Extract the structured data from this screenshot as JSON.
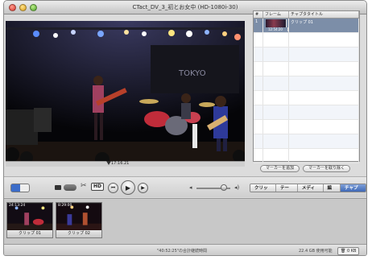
{
  "window": {
    "title": "CTact_DV_3_初とお女中 (HD-1080i-30)"
  },
  "viewer": {
    "playhead_time": "17:16.21",
    "icon": "concert-video-frame"
  },
  "chapters": {
    "columns": [
      "#",
      "フレーム",
      "チャプタタイトル"
    ],
    "rows": [
      {
        "num": "1",
        "time": "12:54:20",
        "title": "クリップ 01",
        "selected": true
      }
    ],
    "empty_rows": 9,
    "add_marker_label": "マーカーを追加",
    "remove_marker_label": "マーカーを取り除く"
  },
  "controls": {
    "hd_label": "HD",
    "rewind_icon": "rewind-icon",
    "play_icon": "play-icon",
    "fullscreen_icon": "fullscreen-icon",
    "tabs": [
      "クリップ",
      "テーマ",
      "メディア",
      "編集",
      "チャプタ"
    ],
    "active_tab": "チャプタ"
  },
  "tray": {
    "clips": [
      {
        "duration": "24:13:24",
        "label": "クリップ 01"
      },
      {
        "duration": "8:29:00",
        "label": "クリップ 02"
      }
    ]
  },
  "status": {
    "total_duration": "\"40:52:25\"の合計継続時間",
    "free_space": "22.4 GB 使用可能",
    "trash_label": "0 KB"
  },
  "colors": {
    "accent": "#3e68b6",
    "selected_row": "#7c8ea8"
  }
}
